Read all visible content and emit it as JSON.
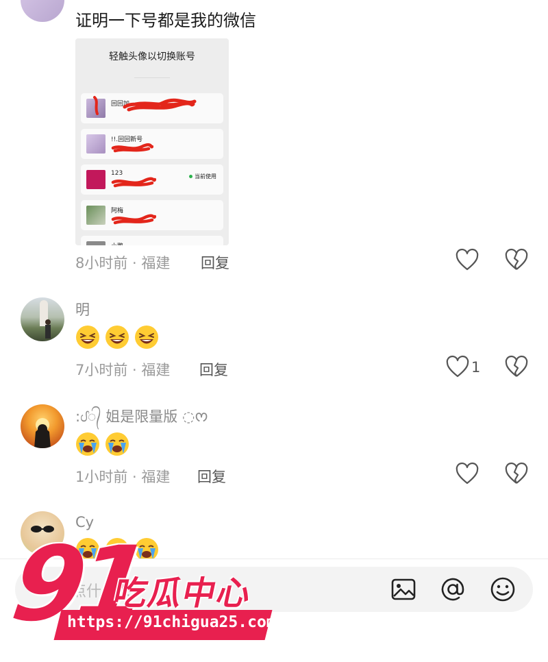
{
  "comments": [
    {
      "username": "",
      "text": "证明一下号都是我的微信",
      "time_location": "8小时前 · 福建",
      "reply_label": "回复",
      "likes": "",
      "screenshot": {
        "title": "轻触头像以切换账号",
        "accounts": [
          {
            "name": "回回加",
            "current": ""
          },
          {
            "name": "!!.回回新号",
            "current": ""
          },
          {
            "name": "123",
            "current": "当前使用"
          },
          {
            "name": "阿梅",
            "current": ""
          },
          {
            "name": "小鹏",
            "current": ""
          }
        ]
      }
    },
    {
      "username": "明",
      "emojis": [
        "grinning-squint-emoji",
        "grinning-squint-emoji",
        "grinning-squint-emoji"
      ],
      "time_location": "7小时前 · 福建",
      "reply_label": "回复",
      "likes": "1"
    },
    {
      "username": ":ᦔ᭄ 姐是限量版 ◌ᰔ",
      "emojis": [
        "loudly-crying-emoji",
        "loudly-crying-emoji"
      ],
      "time_location": "1小时前 · 福建",
      "reply_label": "回复",
      "likes": ""
    },
    {
      "username": "Cy",
      "emojis": [
        "loudly-crying-emoji",
        "loudly-crying-emoji",
        "loudly-crying-emoji"
      ],
      "time_location": "",
      "reply_label": "",
      "likes": ""
    }
  ],
  "input_bar": {
    "placeholder": "说点什么..."
  },
  "watermark": {
    "number": "91",
    "chinese": "吃瓜中心",
    "url": "https://91chigua25.com"
  },
  "colors": {
    "accent": "#e8204f",
    "current_dot": "#2bb24c",
    "scribble": "#e3261b"
  }
}
